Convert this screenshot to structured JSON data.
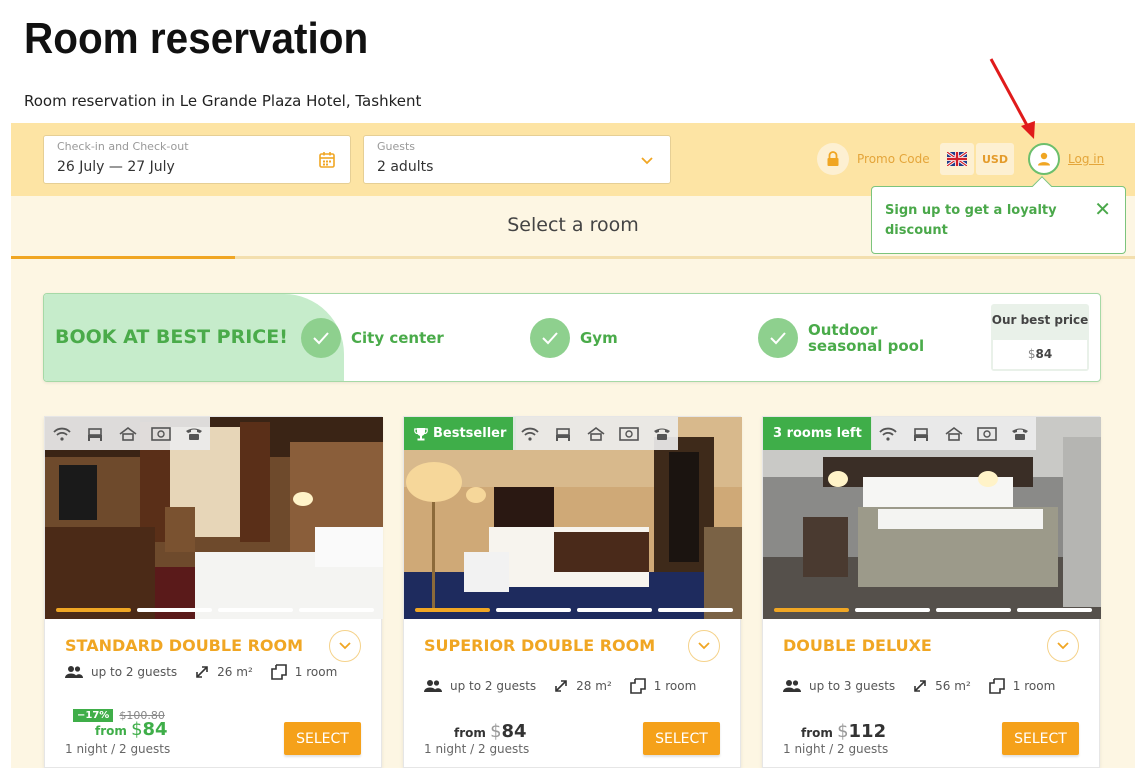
{
  "header": {
    "title": "Room reservation",
    "subtitle": "Room reservation in Le Grande Plaza Hotel, Tashkent"
  },
  "search": {
    "dates_label": "Check-in and Check-out",
    "dates_value": "26 July — 27 July",
    "guests_label": "Guests",
    "guests_value": "2 adults"
  },
  "toolbar": {
    "promo_label": "Promo Code",
    "language_icon": "uk-flag-icon",
    "currency": "USD",
    "login_label": "Log in"
  },
  "tooltip": {
    "text": "Sign up to get a loyalty discount",
    "close": "✕"
  },
  "tab": {
    "title": "Select a room"
  },
  "banner": {
    "title": "BOOK AT BEST PRICE!",
    "features": [
      "City center",
      "Gym",
      "Outdoor seasonal pool"
    ],
    "best_price_label": "Our best price",
    "best_price_currency": "$",
    "best_price_value": "84"
  },
  "rooms": [
    {
      "name": "STANDARD DOUBLE ROOM",
      "badge": "",
      "guests": "up to 2 guests",
      "area": "26 m²",
      "rooms": "1 room",
      "discount": "−17%",
      "old_price": "$100.80",
      "from": "from",
      "currency": "$",
      "price": "84",
      "nights": "1 night / 2 guests",
      "select": "SELECT"
    },
    {
      "name": "SUPERIOR DOUBLE ROOM",
      "badge": "Bestseller",
      "guests": "up to 2 guests",
      "area": "28 m²",
      "rooms": "1 room",
      "from": "from",
      "currency": "$",
      "price": "84",
      "nights": "1 night / 2 guests",
      "select": "SELECT"
    },
    {
      "name": "DOUBLE DELUXE",
      "badge": "3 rooms left",
      "guests": "up to 3 guests",
      "area": "56 m²",
      "rooms": "1 room",
      "from": "from",
      "currency": "$",
      "price": "112",
      "nights": "1 night / 2 guests",
      "select": "SELECT"
    }
  ],
  "colors": {
    "accent": "#f0a623",
    "green": "#3fae49",
    "header_bg": "#fde4a4",
    "widget_bg": "#fdf6e3"
  }
}
